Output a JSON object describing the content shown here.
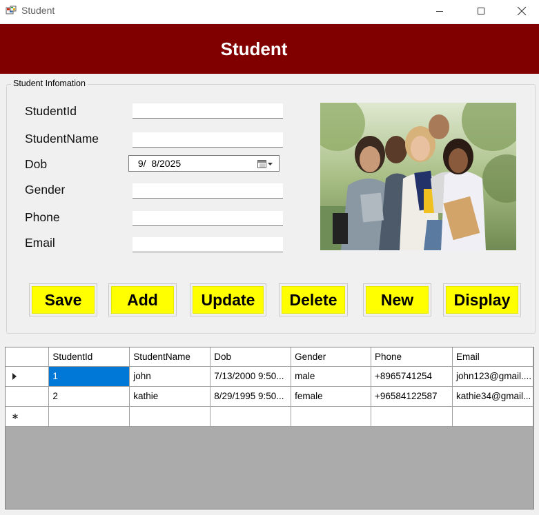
{
  "window": {
    "title": "Student"
  },
  "banner": {
    "title": "Student"
  },
  "group": {
    "legend": "Student Infomation"
  },
  "fields": {
    "student_id": {
      "label": "StudentId",
      "value": ""
    },
    "student_name": {
      "label": "StudentName",
      "value": ""
    },
    "dob": {
      "label": "Dob",
      "value": " 9/  8/2025"
    },
    "gender": {
      "label": "Gender",
      "value": ""
    },
    "phone": {
      "label": "Phone",
      "value": ""
    },
    "email": {
      "label": "Email",
      "value": ""
    }
  },
  "buttons": {
    "save": "Save",
    "add": "Add",
    "update": "Update",
    "delete": "Delete",
    "new": "New",
    "display": "Display"
  },
  "grid": {
    "columns": [
      "StudentId",
      "StudentName",
      "Dob",
      "Gender",
      "Phone",
      "Email"
    ],
    "rows": [
      [
        "1",
        "john",
        "7/13/2000 9:50...",
        "male",
        "+8965741254",
        "john123@gmail...."
      ],
      [
        "2",
        "kathie",
        "8/29/1995 9:50...",
        "female",
        "+96584122587",
        "kathie34@gmail..."
      ]
    ]
  },
  "colors": {
    "banner": "#800000",
    "button": "#ffff00",
    "selection": "#0078d7"
  },
  "icons": [
    "app-icon",
    "minimize-icon",
    "maximize-icon",
    "close-icon",
    "calendar-icon",
    "current-row-arrow-icon",
    "new-row-icon"
  ]
}
